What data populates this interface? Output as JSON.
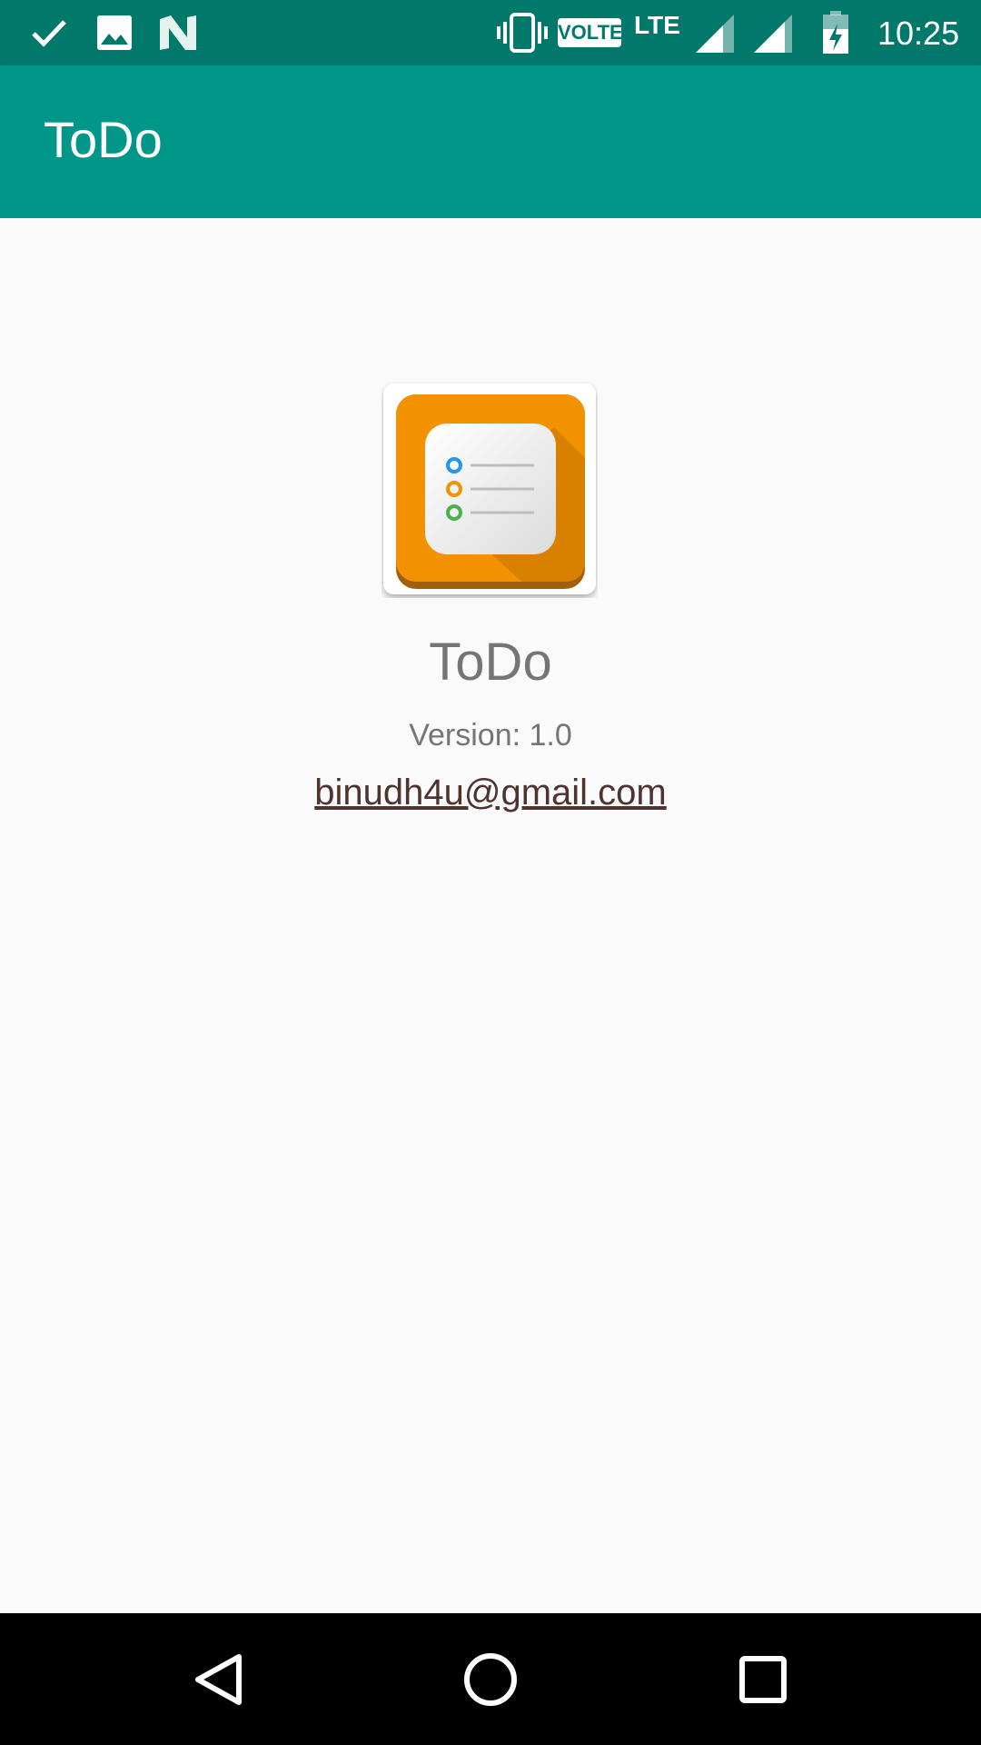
{
  "status_bar": {
    "time": "10:25",
    "network_badge": "VOLTE",
    "network_type": "LTE",
    "icons": [
      "check-icon",
      "image-icon",
      "n-logo-icon",
      "vibrate-icon",
      "signal-icon",
      "signal-icon",
      "battery-charging-icon"
    ]
  },
  "app_bar": {
    "title": "ToDo"
  },
  "about": {
    "app_name": "ToDo",
    "version": "Version: 1.0",
    "email": "binudh4u@gmail.com"
  },
  "nav_bar": {
    "icons": [
      "back-icon",
      "home-icon",
      "recents-icon"
    ]
  },
  "colors": {
    "status_bar": "#00796b",
    "app_bar": "#009688",
    "logo_orange": "#f39200",
    "email_link": "#4e342e"
  }
}
